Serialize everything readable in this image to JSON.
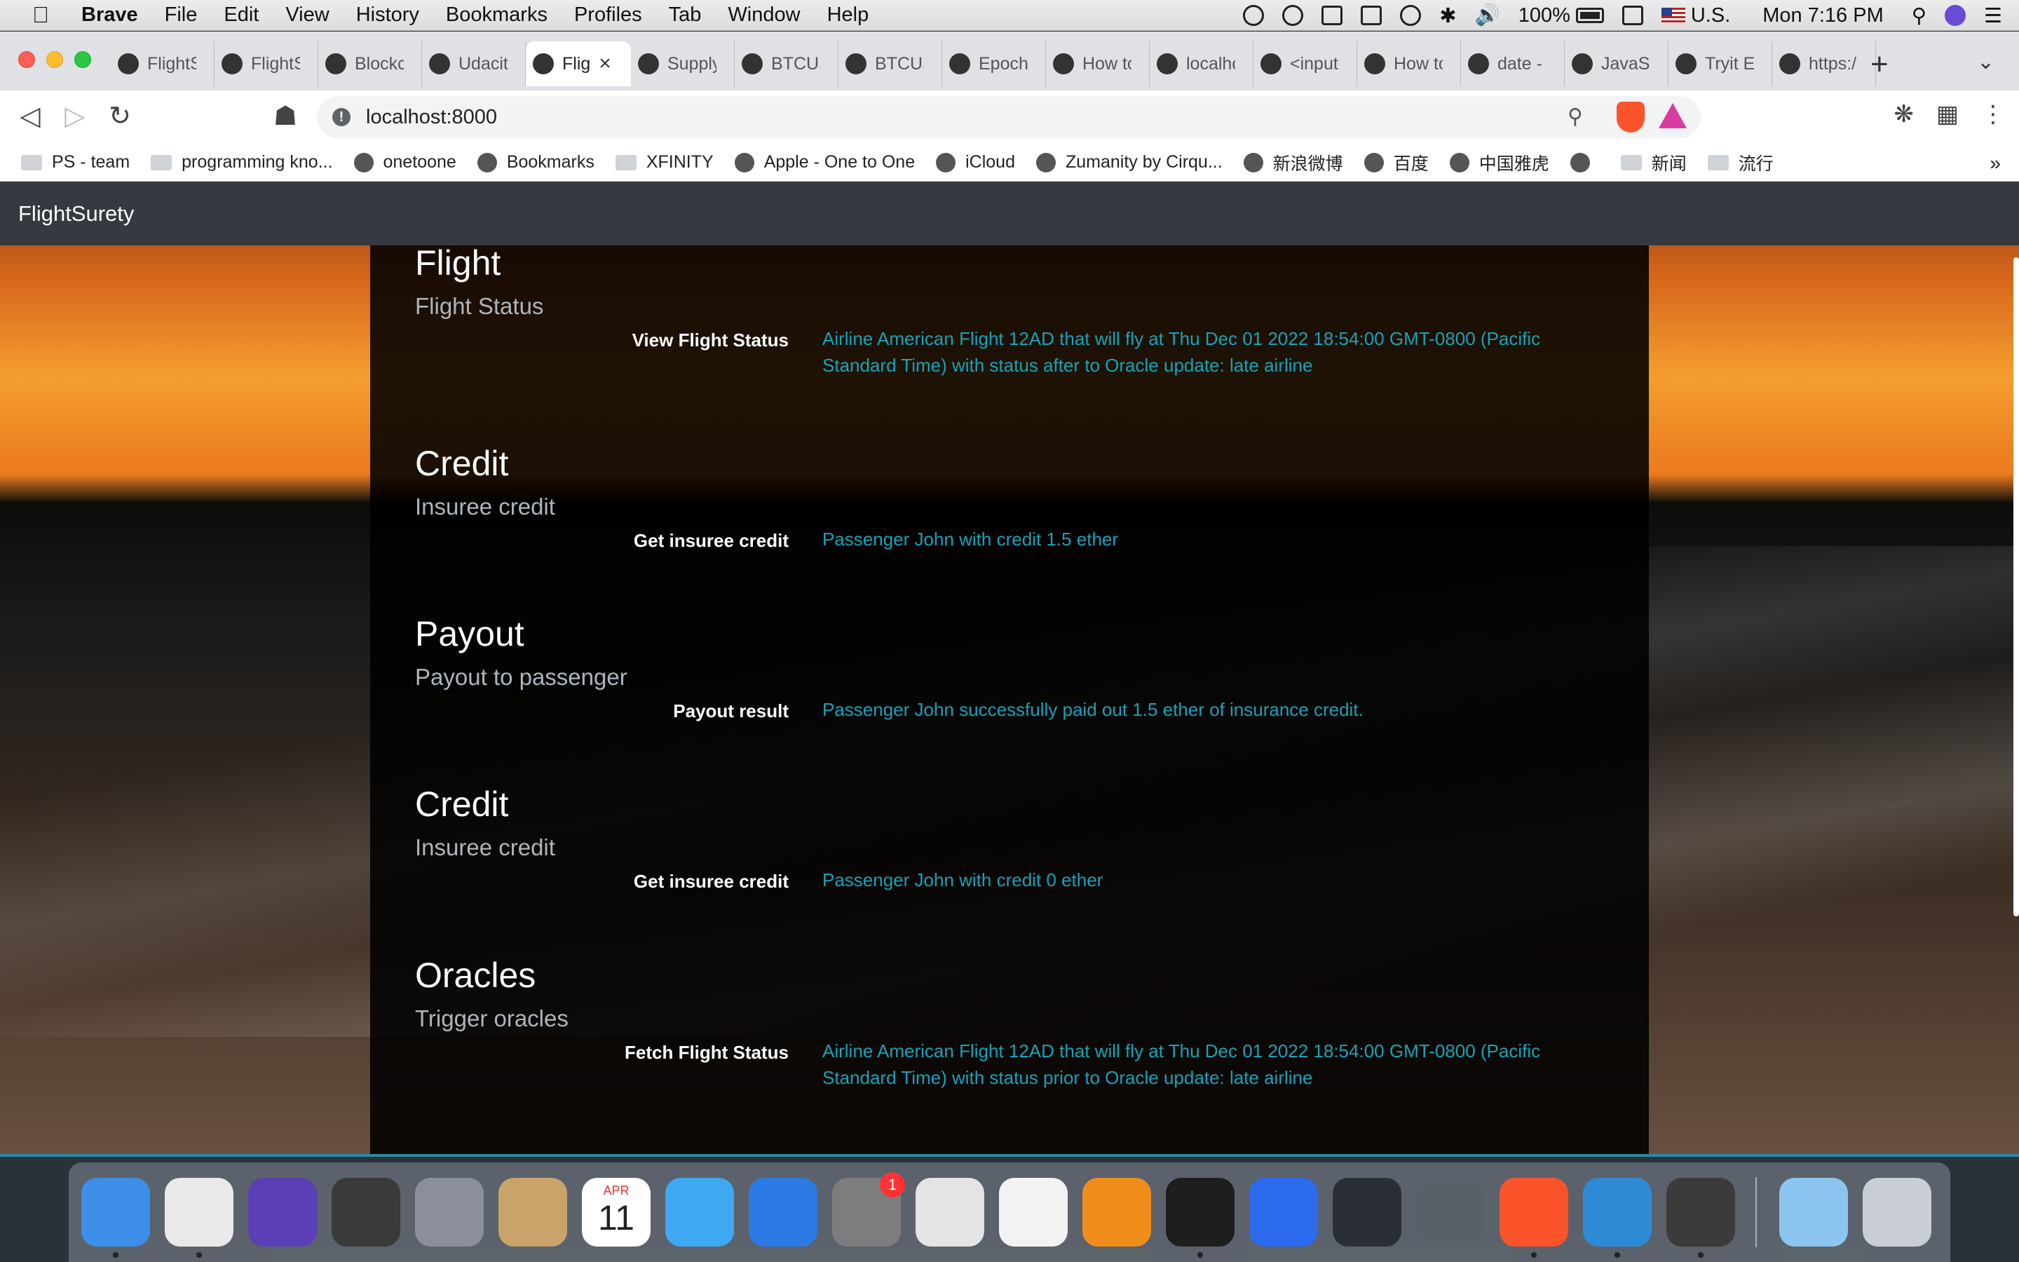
{
  "menubar": {
    "app_name": "Brave",
    "menus": [
      "File",
      "Edit",
      "View",
      "History",
      "Bookmarks",
      "Profiles",
      "Tab",
      "Window",
      "Help"
    ],
    "battery": "100%",
    "input_source": "U.S.",
    "clock": "Mon 7:16 PM"
  },
  "tabs": [
    {
      "title": "FlightS",
      "icon": "github-icon"
    },
    {
      "title": "FlightS",
      "icon": "github-icon"
    },
    {
      "title": "Blockc",
      "icon": "udacity-icon"
    },
    {
      "title": "Udacit",
      "icon": "udacity-icon"
    },
    {
      "title": "Flig",
      "icon": "globe-icon",
      "active": true
    },
    {
      "title": "Supply",
      "icon": "github-icon"
    },
    {
      "title": "BTCUS",
      "icon": "tradingview-icon"
    },
    {
      "title": "BTCUS",
      "icon": "tradingview-icon"
    },
    {
      "title": "Epoch",
      "icon": "clock-icon"
    },
    {
      "title": "How to",
      "icon": "hex-icon"
    },
    {
      "title": "localho",
      "icon": "globe-icon"
    },
    {
      "title": "<input",
      "icon": "mdn-icon"
    },
    {
      "title": "How to",
      "icon": "code-icon"
    },
    {
      "title": "date -",
      "icon": "stackoverflow-icon"
    },
    {
      "title": "JavaSc",
      "icon": "w3schools-icon"
    },
    {
      "title": "Tryit E",
      "icon": "w3schools-icon"
    },
    {
      "title": "https:/",
      "icon": "globe-icon"
    }
  ],
  "address": {
    "url": "localhost:8000"
  },
  "bookmarks": [
    {
      "label": "PS - team",
      "icon": "folder-icon"
    },
    {
      "label": "programming kno...",
      "icon": "folder-icon"
    },
    {
      "label": "onetoone",
      "icon": "globe-icon"
    },
    {
      "label": "Bookmarks",
      "icon": "bookmark-icon"
    },
    {
      "label": "XFINITY",
      "icon": "folder-icon"
    },
    {
      "label": "Apple - One to One",
      "icon": "apple-icon"
    },
    {
      "label": "iCloud",
      "icon": "apple-icon"
    },
    {
      "label": "Zumanity by Cirqu...",
      "icon": "tw-icon"
    },
    {
      "label": "新浪微博",
      "icon": "weibo-icon"
    },
    {
      "label": "百度",
      "icon": "baidu-icon"
    },
    {
      "label": "中国雅虎",
      "icon": "yahoo-icon"
    },
    {
      "label": "",
      "icon": "globe-icon"
    },
    {
      "label": "新闻",
      "icon": "folder-icon"
    },
    {
      "label": "流行",
      "icon": "folder-icon"
    }
  ],
  "app": {
    "brand": "FlightSurety",
    "sections": [
      {
        "heading": "Flight",
        "subheading": "Flight Status",
        "label": "View Flight Status",
        "value": "Airline American Flight 12AD that will fly at Thu Dec 01 2022 18:54:00 GMT-0800 (Pacific Standard Time) with status after to Oracle update: late airline"
      },
      {
        "heading": "Credit",
        "subheading": "Insuree credit",
        "label": "Get insuree credit",
        "value": "Passenger John with credit 1.5 ether"
      },
      {
        "heading": "Payout",
        "subheading": "Payout to passenger",
        "label": "Payout result",
        "value": "Passenger John successfully paid out 1.5 ether of insurance credit."
      },
      {
        "heading": "Credit",
        "subheading": "Insuree credit",
        "label": "Get insuree credit",
        "value": "Passenger John with credit 0 ether"
      },
      {
        "heading": "Oracles",
        "subheading": "Trigger oracles",
        "label": "Fetch Flight Status",
        "value": "Airline American Flight 12AD that will fly at Thu Dec 01 2022 18:54:00 GMT-0800 (Pacific Standard Time) with status prior to Oracle update: late airline"
      }
    ]
  },
  "dock": {
    "apps": [
      {
        "name": "Finder",
        "color": "#3d8ee8",
        "running": true
      },
      {
        "name": "Chrome",
        "color": "#e9e9e9",
        "running": true
      },
      {
        "name": "Siri",
        "color": "#5b3fb6",
        "running": false
      },
      {
        "name": "Activity Monitor",
        "color": "#3a3a3a",
        "running": false
      },
      {
        "name": "Launchpad",
        "color": "#8a8f99",
        "running": false
      },
      {
        "name": "Mail",
        "color": "#c9a46a",
        "running": false
      },
      {
        "name": "Calendar",
        "color": "#ffffff",
        "running": false,
        "date_month": "APR",
        "date_day": "11"
      },
      {
        "name": "Messages",
        "color": "#3fa8f2",
        "running": false
      },
      {
        "name": "Keynote",
        "color": "#2c7be5",
        "running": false
      },
      {
        "name": "System Preferences",
        "color": "#7d7d80",
        "running": false,
        "badge": "1"
      },
      {
        "name": "Preview",
        "color": "#e4e4e4",
        "running": false
      },
      {
        "name": "Photos",
        "color": "#f2f2f2",
        "running": false
      },
      {
        "name": "Books",
        "color": "#f08c1a",
        "running": false
      },
      {
        "name": "Terminal",
        "color": "#1e1e1e",
        "running": true
      },
      {
        "name": "Signal",
        "color": "#2c6bed",
        "running": false
      },
      {
        "name": "Sync",
        "color": "#2a2f35",
        "running": false
      },
      {
        "name": "Help",
        "color": "#5a6068",
        "running": false
      },
      {
        "name": "Brave",
        "color": "#fb542b",
        "running": true
      },
      {
        "name": "VS Code",
        "color": "#2f8ad6",
        "running": true
      },
      {
        "name": "Sublime Text",
        "color": "#3b3b3b",
        "running": true
      },
      {
        "name": "Applications Folder",
        "color": "#8cc6f0",
        "running": false
      },
      {
        "name": "Trash",
        "color": "#c9ced4",
        "running": false
      }
    ]
  }
}
